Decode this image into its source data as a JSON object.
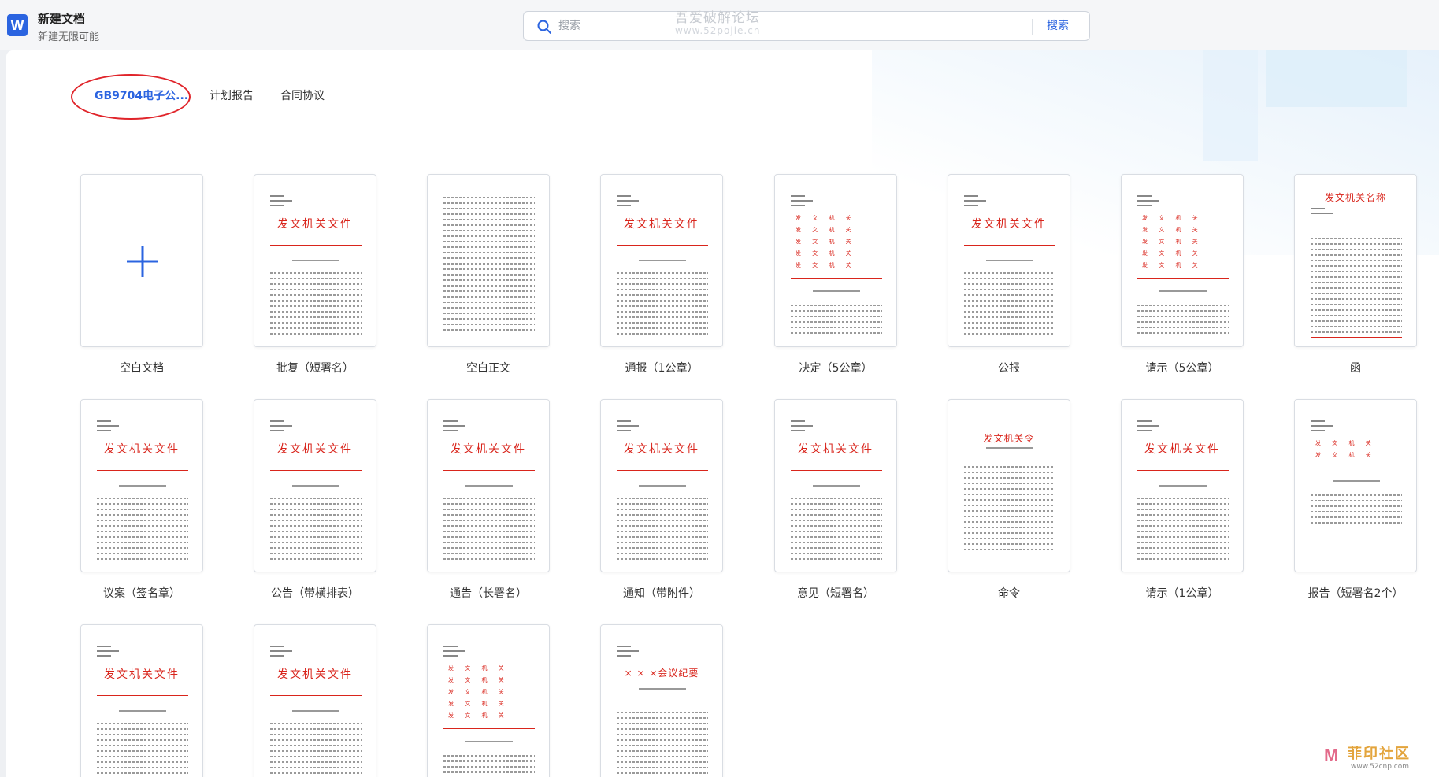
{
  "app": {
    "title": "新建文档",
    "subtitle": "新建无限可能",
    "icon_letter": "W"
  },
  "search": {
    "placeholder": "搜索",
    "button_label": "搜索"
  },
  "watermark_top": {
    "text": "吾爱破解论坛",
    "url": "www.52pojie.cn"
  },
  "watermark_bottom": {
    "text": "菲印社区",
    "url": "www.52cnp.com"
  },
  "tabs": [
    {
      "label": "GB9704电子公...",
      "active": true
    },
    {
      "label": "计划报告",
      "active": false
    },
    {
      "label": "合同协议",
      "active": false
    }
  ],
  "templates": [
    {
      "label": "空白文档",
      "kind": "blank",
      "thumb_title": ""
    },
    {
      "label": "批复（短署名）",
      "kind": "header",
      "thumb_title": "发文机关文件"
    },
    {
      "label": "空白正文",
      "kind": "body",
      "thumb_title": ""
    },
    {
      "label": "通报（1公章）",
      "kind": "header",
      "thumb_title": "发文机关文件"
    },
    {
      "label": "决定（5公章）",
      "kind": "multi",
      "thumb_title": "发 文 机 关"
    },
    {
      "label": "公报",
      "kind": "header",
      "thumb_title": "发文机关文件"
    },
    {
      "label": "请示（5公章）",
      "kind": "multi",
      "thumb_title": "发 文 机 关"
    },
    {
      "label": "函",
      "kind": "letter",
      "thumb_title": "发文机关名称"
    },
    {
      "label": "议案（签名章）",
      "kind": "header",
      "thumb_title": "发文机关文件"
    },
    {
      "label": "公告（带横排表）",
      "kind": "header",
      "thumb_title": "发文机关文件"
    },
    {
      "label": "通告（长署名）",
      "kind": "header",
      "thumb_title": "发文机关文件"
    },
    {
      "label": "通知（带附件）",
      "kind": "header",
      "thumb_title": "发文机关文件"
    },
    {
      "label": "意见（短署名）",
      "kind": "header",
      "thumb_title": "发文机关文件"
    },
    {
      "label": "命令",
      "kind": "order",
      "thumb_title": "发文机关令"
    },
    {
      "label": "请示（1公章）",
      "kind": "header",
      "thumb_title": "发文机关文件"
    },
    {
      "label": "报告（短署名2个）",
      "kind": "multi2",
      "thumb_title": "发 文 机 关"
    },
    {
      "label": "",
      "kind": "header",
      "thumb_title": "发文机关文件"
    },
    {
      "label": "",
      "kind": "header",
      "thumb_title": "发文机关文件"
    },
    {
      "label": "",
      "kind": "multi",
      "thumb_title": "发 文 机 关"
    },
    {
      "label": "",
      "kind": "minutes",
      "thumb_title": "× × ×会议纪要"
    }
  ],
  "colors": {
    "accent": "#2b64e0",
    "doc_red": "#d9251c",
    "highlight_circle": "#e0242a"
  }
}
